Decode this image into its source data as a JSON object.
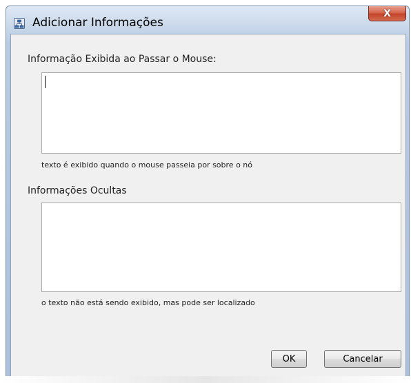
{
  "window": {
    "title": "Adicionar Informações",
    "close_label": "X"
  },
  "tooltip_section": {
    "label": "Informação Exibida ao Passar o Mouse:",
    "value": "",
    "hint": "texto é exibido quando o mouse passeia por sobre o nó"
  },
  "hidden_section": {
    "label": "Informações Ocultas",
    "value": "",
    "hint": "o texto não está sendo exibido, mas pode ser localizado"
  },
  "buttons": {
    "ok_label": "OK",
    "cancel_label": "Cancelar"
  }
}
